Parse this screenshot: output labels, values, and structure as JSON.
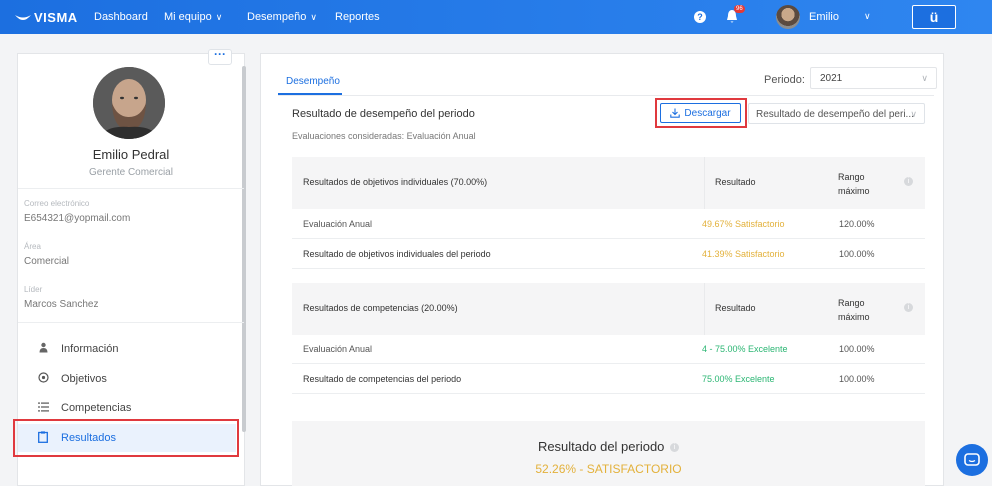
{
  "topbar": {
    "logo": "VISMA",
    "nav": [
      {
        "label": "Dashboard",
        "has_menu": false
      },
      {
        "label": "Mi equipo",
        "has_menu": true
      },
      {
        "label": "Desempeño",
        "has_menu": true
      },
      {
        "label": "Reportes",
        "has_menu": false
      }
    ],
    "notification_count": "96",
    "user_name": "Emilio",
    "brand_button": "ü"
  },
  "profile": {
    "name": "Emilio Pedral",
    "role": "Gerente Comercial",
    "fields": [
      {
        "label": "Correo electrónico",
        "value": "E654321@yopmail.com"
      },
      {
        "label": "Área",
        "value": "Comercial"
      },
      {
        "label": "Líder",
        "value": "Marcos Sanchez"
      }
    ],
    "menu": [
      {
        "label": "Información",
        "icon": "user-icon",
        "active": false
      },
      {
        "label": "Objetivos",
        "icon": "target-icon",
        "active": false
      },
      {
        "label": "Competencias",
        "icon": "list-icon",
        "active": false
      },
      {
        "label": "Resultados",
        "icon": "clipboard-icon",
        "active": true
      }
    ]
  },
  "main": {
    "tab": "Desempeño",
    "period_label": "Periodo:",
    "period_value": "2021",
    "section_title": "Resultado de desempeño del periodo",
    "section_subtitle": "Evaluaciones consideradas: Evaluación Anual",
    "download_label": "Descargar",
    "result_select": "Resultado de desempeño del peri...",
    "objectives": {
      "header": [
        "Resultados de objetivos individuales (70.00%)",
        "Resultado",
        "Rango",
        "máximo"
      ],
      "rows": [
        {
          "name": "Evaluación Anual",
          "result": "49.67% Satisfactorio",
          "max": "120.00%"
        },
        {
          "name": "Resultado de objetivos individuales del periodo",
          "result": "41.39% Satisfactorio",
          "max": "100.00%"
        }
      ]
    },
    "competencies": {
      "header": [
        "Resultados de competencias (20.00%)",
        "Resultado",
        "Rango",
        "máximo"
      ],
      "rows": [
        {
          "name": "Evaluación Anual",
          "result": "4 - 75.00% Excelente",
          "max": "100.00%"
        },
        {
          "name": "Resultado de competencias del periodo",
          "result": "75.00% Excelente",
          "max": "100.00%"
        }
      ]
    },
    "summary": {
      "title": "Resultado del periodo",
      "value": "52.26% - SATISFACTORIO"
    }
  },
  "colors": {
    "primary": "#1c6fe0",
    "satisfactory": "#e3b13b",
    "excellent": "#2bb673",
    "highlight": "#e0393e"
  }
}
